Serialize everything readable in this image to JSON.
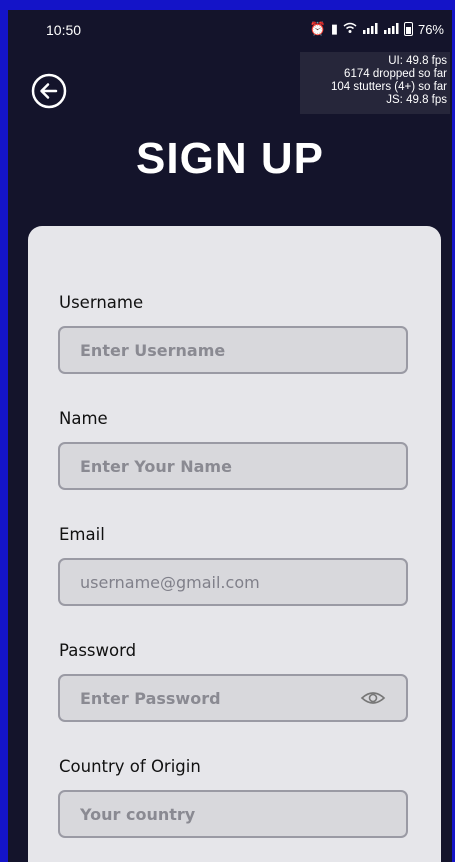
{
  "status_bar": {
    "time": "10:50",
    "battery": "76%",
    "icons": [
      "alarm-icon",
      "vibrate-icon",
      "wifi-icon",
      "signal-icon",
      "signal-icon",
      "battery-icon"
    ]
  },
  "perf_overlay": {
    "ui_fps": "UI: 49.8 fps",
    "dropped": "6174 dropped so far",
    "stutters": "104 stutters (4+) so far",
    "js_fps": "JS: 49.8 fps"
  },
  "header": {
    "back_icon": "arrow-left-circle-icon",
    "title": "SIGN UP"
  },
  "form": {
    "fields": [
      {
        "label": "Username",
        "placeholder": "Enter Username",
        "value": ""
      },
      {
        "label": "Name",
        "placeholder": "Enter Your Name",
        "value": ""
      },
      {
        "label": "Email",
        "placeholder": "username@gmail.com",
        "value": ""
      },
      {
        "label": "Password",
        "placeholder": "Enter Password",
        "value": "",
        "icon": "eye-icon"
      },
      {
        "label": "Country of Origin",
        "placeholder": "Your country",
        "value": ""
      }
    ]
  },
  "colors": {
    "background": "#14142b",
    "frame": "#1414c8",
    "card": "#e6e6ea",
    "input_bg": "#d8d8dc",
    "input_border": "#9a9aa4"
  }
}
